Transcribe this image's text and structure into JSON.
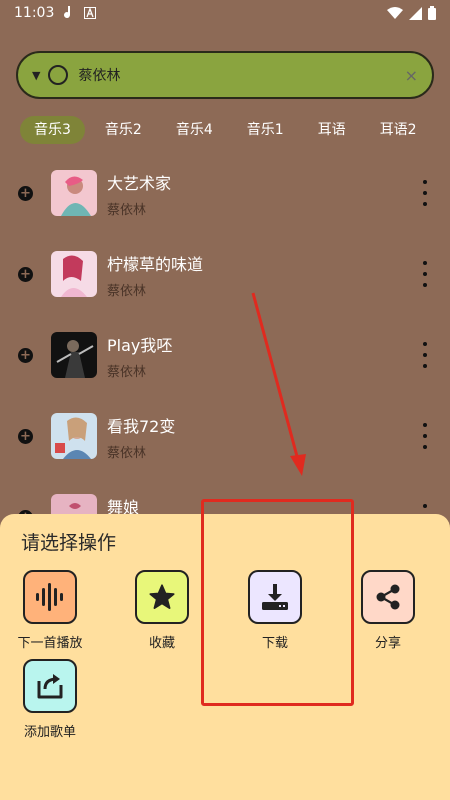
{
  "status_bar": {
    "time": "11:03"
  },
  "search": {
    "value": "蔡依林",
    "clear_glyph": "×"
  },
  "tabs": [
    {
      "label": "音乐3",
      "active": true
    },
    {
      "label": "音乐2",
      "active": false
    },
    {
      "label": "音乐4",
      "active": false
    },
    {
      "label": "音乐1",
      "active": false
    },
    {
      "label": "耳语",
      "active": false
    },
    {
      "label": "耳语2",
      "active": false
    }
  ],
  "songs": [
    {
      "title": "大艺术家",
      "artist": "蔡依林"
    },
    {
      "title": "柠檬草的味道",
      "artist": "蔡依林"
    },
    {
      "title": "Play我呸",
      "artist": "蔡依林"
    },
    {
      "title": "看我72变",
      "artist": "蔡依林"
    },
    {
      "title": "舞娘",
      "artist": ""
    }
  ],
  "sheet": {
    "title": "请选择操作",
    "actions": [
      {
        "label": "下一首播放",
        "icon": "waveform-icon",
        "color": "#ffb27a"
      },
      {
        "label": "收藏",
        "icon": "star-icon",
        "color": "#e8f77a"
      },
      {
        "label": "下载",
        "icon": "download-icon",
        "color": "#ece6ff"
      },
      {
        "label": "分享",
        "icon": "share-icon",
        "color": "#ffd8c8"
      },
      {
        "label": "添加歌单",
        "icon": "add-to-playlist-icon",
        "color": "#b9f5ee"
      }
    ]
  },
  "colors": {
    "background": "#8d6a56",
    "search_bg": "#8aa43f",
    "active_tab": "#7f8438",
    "sheet_bg": "#ffdf9e",
    "annotation": "#e02a1f"
  }
}
